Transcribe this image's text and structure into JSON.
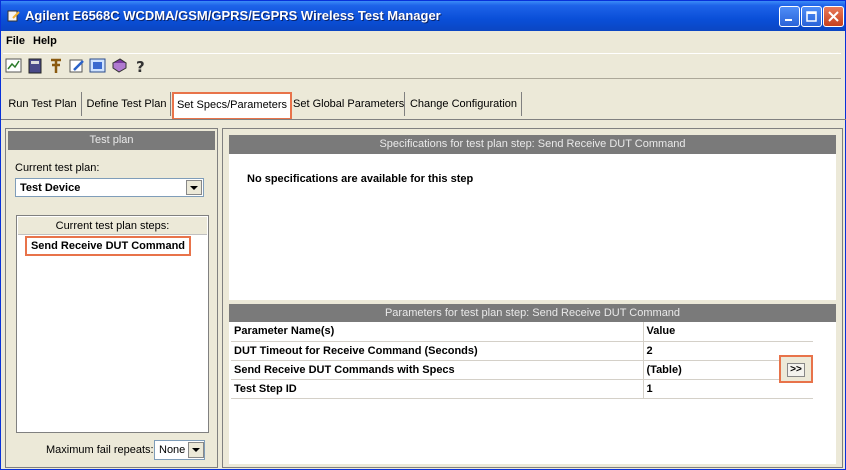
{
  "window": {
    "title": "Agilent E6568C WCDMA/GSM/GPRS/EGPRS Wireless Test Manager"
  },
  "menu": [
    {
      "label": "File"
    },
    {
      "label": "Help"
    }
  ],
  "toolbar": {
    "icons": [
      "chart-icon",
      "notebook-icon",
      "tools-icon",
      "edit-icon",
      "image-icon",
      "book-icon",
      "help-icon"
    ]
  },
  "tabs": [
    {
      "label": "Run Test Plan"
    },
    {
      "label": "Define Test Plan"
    },
    {
      "label": "Set Specs/Parameters"
    },
    {
      "label": "Set Global Parameters"
    },
    {
      "label": "Change Configuration"
    }
  ],
  "left": {
    "header": "Test plan",
    "current_label": "Current test plan:",
    "current_value": "Test Device",
    "steps_header": "Current test plan steps:",
    "steps": [
      "Send Receive DUT Command"
    ],
    "fail_label": "Maximum fail repeats:",
    "fail_value": "None"
  },
  "right": {
    "spec_header": "Specifications for test plan step: Send Receive DUT Command",
    "spec_message": "No specifications are available for this step",
    "param_header": "Parameters for test plan step: Send Receive DUT Command",
    "columns": [
      "Parameter Name(s)",
      "Value"
    ],
    "rows": [
      {
        "name": "DUT Timeout for Receive Command (Seconds)",
        "value": "2"
      },
      {
        "name": "Send Receive DUT Commands with Specs",
        "value": "(Table)"
      },
      {
        "name": "Test Step ID",
        "value": "1"
      }
    ],
    "more_button": ">>"
  },
  "colors": {
    "highlight": "#e8734a",
    "header_gray": "#7a7a7a",
    "titlebar": "#0a4fd8"
  }
}
